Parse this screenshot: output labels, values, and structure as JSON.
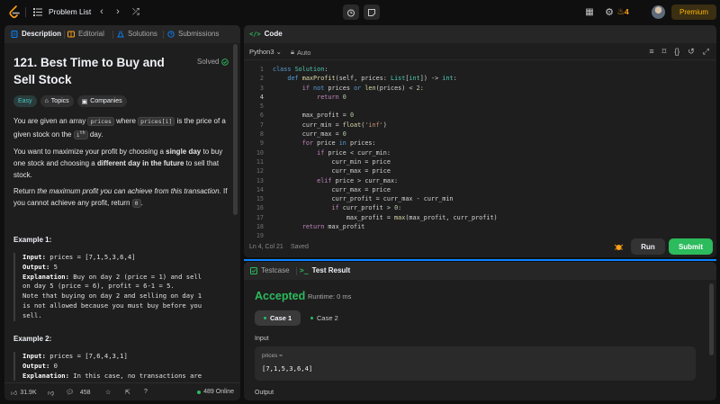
{
  "topbar": {
    "title": "Problem List",
    "streak": "4",
    "premium": "Premium"
  },
  "left": {
    "tabs": [
      {
        "label": "Description",
        "color": "#0a84ff"
      },
      {
        "label": "Editorial",
        "color": "#ffa116"
      },
      {
        "label": "Solutions",
        "color": "#0a84ff"
      },
      {
        "label": "Submissions",
        "color": "#0a84ff"
      }
    ],
    "problem_title": "121. Best Time to Buy and Sell Stock",
    "solved": "Solved",
    "difficulty": "Easy",
    "topics": "Topics",
    "companies": "Companies",
    "para1": {
      "a": "You are given an array ",
      "code1": "prices",
      "b": " where ",
      "code2": "prices[i]",
      "c": " is the price of a given stock on the ",
      "code3": "i",
      "sup": "th",
      "d": " day."
    },
    "para2": {
      "a": "You want to maximize your profit by choosing a ",
      "b": "single day",
      "c": " to buy one stock and choosing a ",
      "d": "different day in the future",
      "e": " to sell that stock."
    },
    "para3": {
      "a": "Return ",
      "b": "the maximum profit you can achieve from this transaction",
      "c": ". If you cannot achieve any profit, return ",
      "code": "0",
      "d": "."
    },
    "example1": {
      "title": "Example 1:",
      "input_label": "Input:",
      "input": " prices = [7,1,5,3,6,4]",
      "output_label": "Output:",
      "output": " 5",
      "expl_label": "Explanation:",
      "expl1": " Buy on day 2 (price = 1) and sell",
      "expl2": "on day 5 (price = 6), profit = 6-1 = 5.",
      "expl3": "Note that buying on day 2 and selling on day 1",
      "expl4": "is not allowed because you must buy before you",
      "expl5": "sell."
    },
    "example2": {
      "title": "Example 2:",
      "input_label": "Input:",
      "input": " prices = [7,6,4,3,1]",
      "output_label": "Output:",
      "output": " 0",
      "expl_label": "Explanation:",
      "expl1": " In this case, no transactions are"
    },
    "footer": {
      "likes": "31.9K",
      "comments": "458",
      "online": "489 Online"
    }
  },
  "code": {
    "header": "Code",
    "language": "Python3",
    "mode": "Auto",
    "status": "Ln 4, Col 21",
    "saved": "Saved",
    "run": "Run",
    "submit": "Submit",
    "current_line": 4,
    "line_numbers": [
      "1",
      "2",
      "3",
      "4",
      "5",
      "6",
      "7",
      "8",
      "9",
      "10",
      "11",
      "12",
      "13",
      "14",
      "15",
      "16",
      "17",
      "18",
      "19"
    ]
  },
  "result": {
    "tabs": [
      "Testcase",
      "Test Result"
    ],
    "verdict": "Accepted",
    "runtime": "Runtime: 0 ms",
    "cases": [
      "Case 1",
      "Case 2"
    ],
    "input_label": "Input",
    "var_name": "prices =",
    "var_value": "[7,1,5,3,6,4]",
    "output_label": "Output"
  }
}
